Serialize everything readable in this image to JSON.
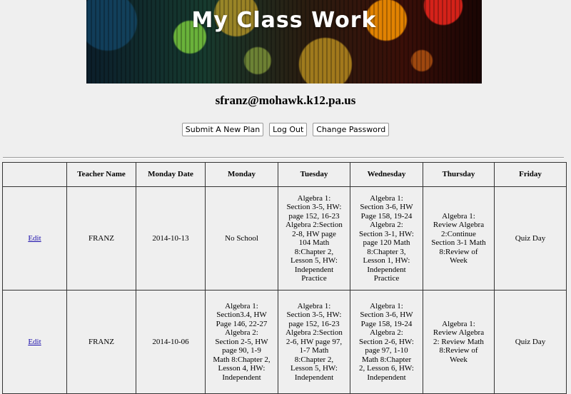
{
  "banner": {
    "title": "My Class Work"
  },
  "user": {
    "email": "sfranz@mohawk.k12.pa.us"
  },
  "actions": {
    "submit_label": "Submit A New Plan",
    "logout_label": "Log Out",
    "change_password_label": "Change Password"
  },
  "table": {
    "headers": [
      "",
      "Teacher Name",
      "Monday Date",
      "Monday",
      "Tuesday",
      "Wednesday",
      "Thursday",
      "Friday"
    ],
    "rows": [
      {
        "edit": "Edit",
        "teacher": "FRANZ",
        "date": "2014-10-13",
        "monday": "No School",
        "tuesday": "Algebra 1:\nSection 3-5, HW:\npage 152, 16-23\nAlgebra 2:Section\n2-8, HW page\n104 Math\n8:Chapter 2,\nLesson 5, HW:\nIndependent\nPractice",
        "wednesday": "Algebra 1:\nSection 3-6, HW\nPage 158, 19-24\nAlgebra 2:\nSection 3-1, HW:\npage 120 Math\n8:Chapter 3,\nLesson 1, HW:\nIndependent\nPractice",
        "thursday": "Algebra 1:\nReview Algebra\n2:Continue\nSection 3-1 Math\n8:Review of\nWeek",
        "friday": "Quiz Day"
      },
      {
        "edit": "Edit",
        "teacher": "FRANZ",
        "date": "2014-10-06",
        "monday": "Algebra 1:\nSection3.4, HW\nPage 146, 22-27\nAlgebra 2:\nSection 2-5, HW\npage 90, 1-9\nMath 8:Chapter 2,\nLesson 4, HW:\nIndependent",
        "tuesday": "Algebra 1:\nSection 3-5, HW:\npage 152, 16-23\nAlgebra 2:Section\n2-6, HW page 97,\n1-7 Math\n8:Chapter 2,\nLesson 5, HW:\nIndependent",
        "wednesday": "Algebra 1:\nSection 3-6, HW\nPage 158, 19-24\nAlgebra 2:\nSection 2-6, HW:\npage 97, 1-10\nMath 8:Chapter\n2, Lesson 6, HW:\nIndependent",
        "thursday": "Algebra 1:\nReview Algebra\n2: Review Math\n8:Review of\nWeek",
        "friday": "Quiz Day"
      }
    ]
  }
}
